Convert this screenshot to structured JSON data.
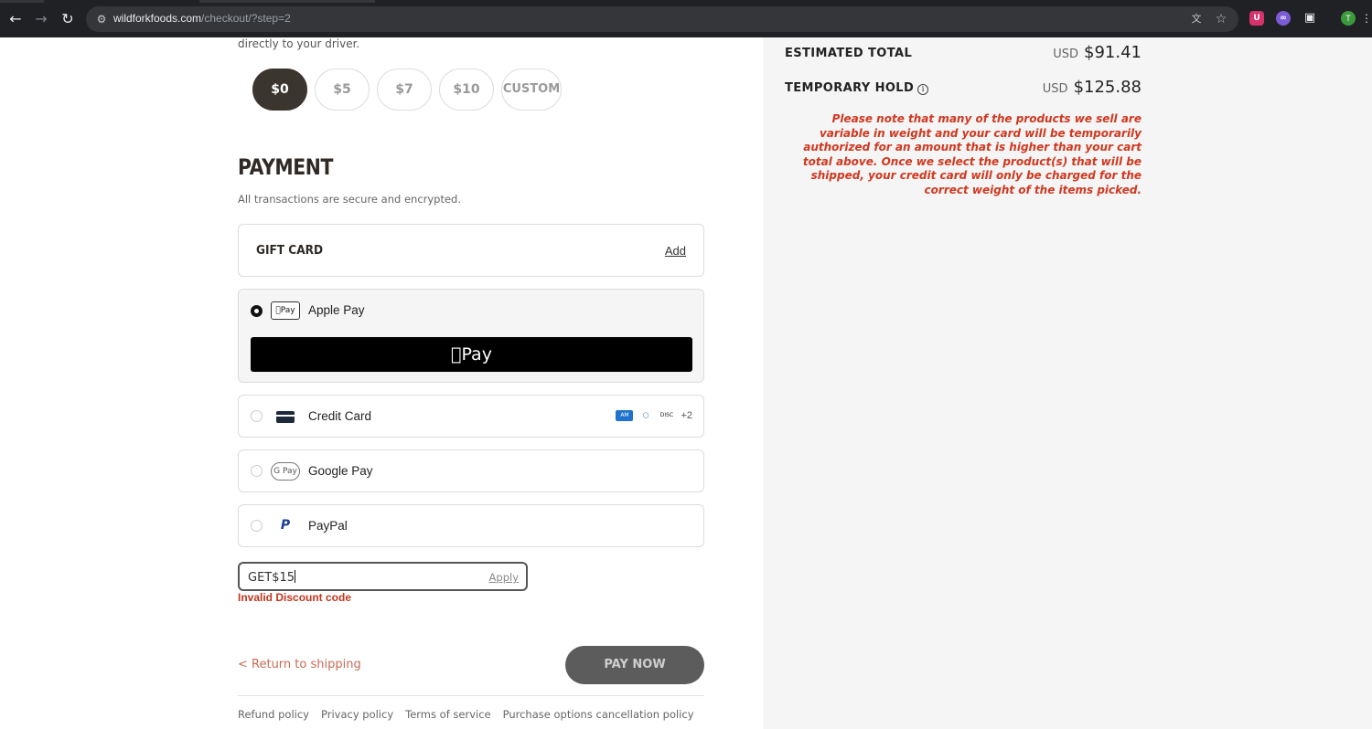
{
  "browser": {
    "url_domain": "wildforkfoods.com",
    "url_path": "/checkout/?step=2",
    "icons": {
      "back": "arrow-left-icon",
      "forward": "arrow-right-icon",
      "reload": "reload-icon",
      "site_settings": "tune-icon",
      "translate": "translate-icon",
      "bookmark": "star-icon",
      "extensions": "puzzle-icon"
    },
    "avatar_initial": "T"
  },
  "tip": {
    "driver_text": "directly to your driver.",
    "options": [
      "$0",
      "$5",
      "$7",
      "$10",
      "CUSTOM"
    ],
    "selected": "$0"
  },
  "payment": {
    "title": "PAYMENT",
    "subtitle": "All transactions are secure and encrypted.",
    "gift_card": {
      "label": "GIFT CARD",
      "add_link": "Add"
    },
    "methods": [
      {
        "label": "Apple Pay",
        "icon": "apple-pay-icon",
        "selected": true,
        "badge": "Pay",
        "button_label": "Pay"
      },
      {
        "label": "Credit Card",
        "icon": "credit-card-icon",
        "selected": false,
        "more_brands": "+2"
      },
      {
        "label": "Google Pay",
        "icon": "google-pay-icon",
        "selected": false,
        "badge": "G Pay"
      },
      {
        "label": "PayPal",
        "icon": "paypal-icon",
        "selected": false,
        "badge": "P"
      }
    ]
  },
  "discount": {
    "value": "GET$15",
    "apply_label": "Apply",
    "error": "Invalid Discount code"
  },
  "footer": {
    "return_link": "< Return to shipping",
    "pay_now": "PAY NOW",
    "policies": [
      "Refund policy",
      "Privacy policy",
      "Terms of service",
      "Purchase options cancellation policy"
    ]
  },
  "summary": {
    "estimated_total_label": "ESTIMATED TOTAL",
    "estimated_total_currency": "USD",
    "estimated_total_amount": "$91.41",
    "temporary_hold_label": "TEMPORARY HOLD",
    "temporary_hold_currency": "USD",
    "temporary_hold_amount": "$125.88",
    "note": "Please note that many of the products we sell are variable in weight and your card will be temporarily authorized for an amount that is higher than your cart total above. Once we select the product(s) that will be shipped, your credit card will only be charged for the correct weight of the items picked."
  },
  "colors": {
    "accent_dark": "#3b352f",
    "error_red": "#c0381f",
    "note_red": "#d0381f",
    "panel_bg": "#f5f5f5"
  }
}
